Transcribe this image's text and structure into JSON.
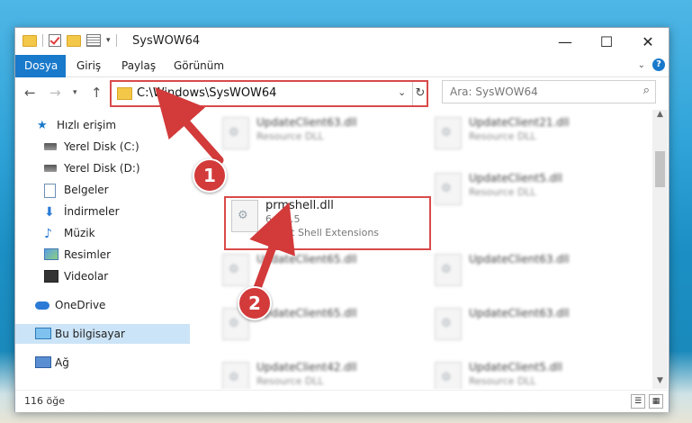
{
  "title": "SysWOW64",
  "ribbon": {
    "tabs": [
      "Dosya",
      "Giriş",
      "Paylaş",
      "Görünüm"
    ]
  },
  "window_controls": {
    "minimize": "—",
    "maximize": "☐",
    "close": "✕"
  },
  "address": {
    "path": "C:\\Windows\\SysWOW64"
  },
  "search": {
    "placeholder": "Ara: SysWOW64"
  },
  "nav": {
    "items": [
      {
        "label": "Hızlı erişim",
        "icon": "star-icon"
      },
      {
        "label": "Yerel Disk (C:)",
        "icon": "disk-icon"
      },
      {
        "label": "Yerel Disk (D:)",
        "icon": "disk-icon"
      },
      {
        "label": "Belgeler",
        "icon": "documents-icon"
      },
      {
        "label": "İndirmeler",
        "icon": "downloads-icon"
      },
      {
        "label": "Müzik",
        "icon": "music-icon"
      },
      {
        "label": "Resimler",
        "icon": "pictures-icon"
      },
      {
        "label": "Videolar",
        "icon": "videos-icon"
      },
      {
        "label": "OneDrive",
        "icon": "onedrive-icon"
      },
      {
        "label": "Bu bilgisayar",
        "icon": "this-pc-icon"
      },
      {
        "label": "Ağ",
        "icon": "network-icon"
      }
    ]
  },
  "highlighted_file": {
    "name": "prmshell.dll",
    "version": "6.0.0.5",
    "description": "Promt Shell Extensions"
  },
  "files": [
    {
      "name": "UpdateClient63.dll",
      "type": "Resource DLL"
    },
    {
      "name": "UpdateClient21.dll",
      "type": "Resource DLL"
    },
    {
      "name": "UpdateClient5.dll",
      "type": "Resource DLL"
    },
    {
      "name": "UpdateClient65.dll",
      "type": "Resource DLL"
    },
    {
      "name": "UpdateClient63.dll",
      "type": "Resource DLL"
    },
    {
      "name": "UpdateClient65.dll",
      "type": "Resource DLL"
    },
    {
      "name": "UpdateClient63.dll",
      "type": "Resource DLL"
    },
    {
      "name": "UpdateClient42.dll",
      "type": "Resource DLL"
    },
    {
      "name": "UpdateClient5.dll",
      "type": "Resource DLL"
    }
  ],
  "status": {
    "count": "116 öğe"
  },
  "annotations": {
    "step1": "1",
    "step2": "2"
  },
  "colors": {
    "accent": "#1979ca",
    "highlight": "#d94a4a",
    "selected": "#cce4f7"
  }
}
